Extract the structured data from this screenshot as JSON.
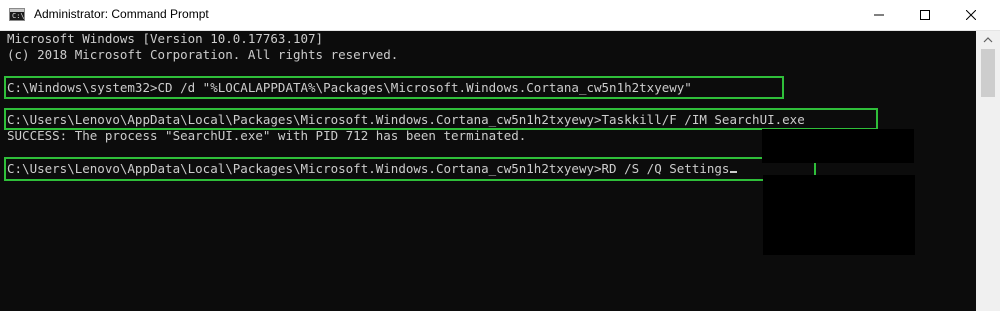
{
  "window": {
    "title": "Administrator: Command Prompt",
    "icon_name": "command-prompt-icon",
    "icon_glyph": "C:\\",
    "controls": [
      "minimize-icon",
      "maximize-icon",
      "close-icon"
    ]
  },
  "console": {
    "lines": [
      "Microsoft Windows [Version 10.0.17763.107]",
      "(c) 2018 Microsoft Corporation. All rights reserved.",
      "C:\\Windows\\system32>CD /d \"%LOCALAPPDATA%\\Packages\\Microsoft.Windows.Cortana_cw5n1h2txyewy\"",
      "C:\\Users\\Lenovo\\AppData\\Local\\Packages\\Microsoft.Windows.Cortana_cw5n1h2txyewy>Taskkill/F /IM SearchUI.exe",
      "SUCCESS: The process \"SearchUI.exe\" with PID 712 has been terminated.",
      "C:\\Users\\Lenovo\\AppData\\Local\\Packages\\Microsoft.Windows.Cortana_cw5n1h2txyewy>RD /S /Q Settings"
    ]
  },
  "colors": {
    "console_background": "#0c0c0c",
    "console_text": "#cccccc",
    "highlight": "#2fbf3a"
  }
}
